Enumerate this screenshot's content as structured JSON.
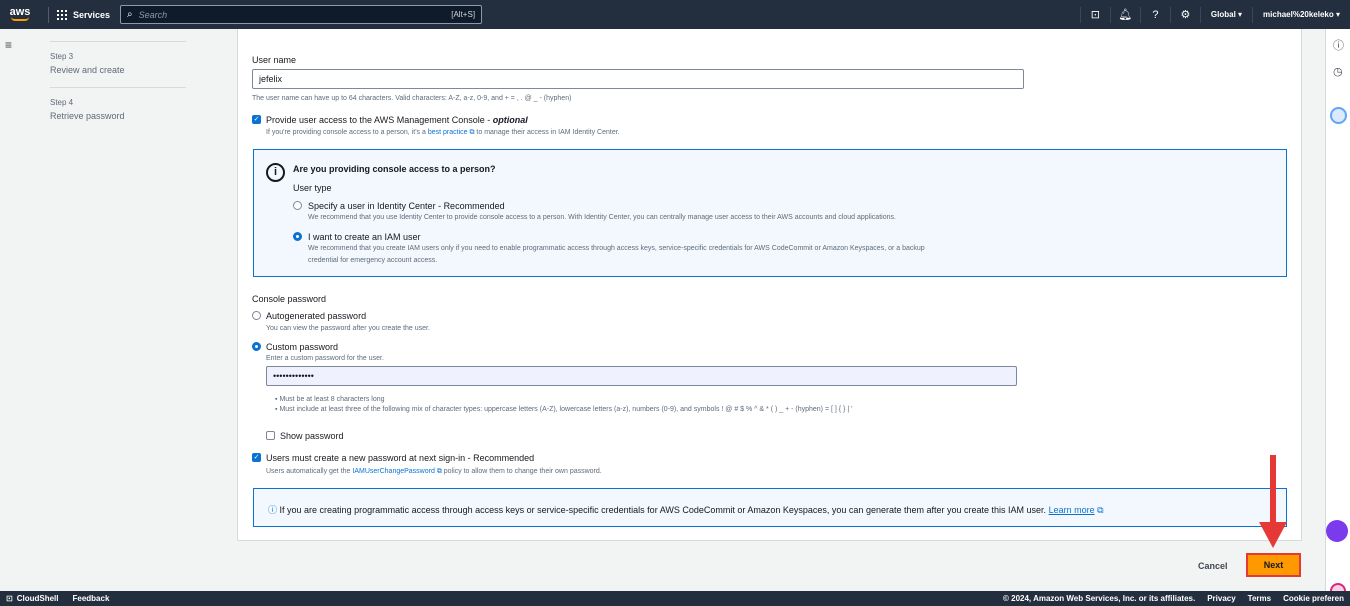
{
  "topnav": {
    "logo": "aws",
    "services": "Services",
    "search_placeholder": "Search",
    "search_shortcut": "[Alt+S]",
    "region": "Global ▾",
    "account": "michael%20keleko ▾"
  },
  "steps": [
    {
      "num": "Step 3",
      "name": "Review and create"
    },
    {
      "num": "Step 4",
      "name": "Retrieve password"
    }
  ],
  "form": {
    "username_label": "User name",
    "username_value": "jefelix",
    "username_hint": "The user name can have up to 64 characters. Valid characters: A-Z, a-z, 0-9, and + = , . @ _ - (hyphen)",
    "console_access_label": "Provide user access to the AWS Management Console - ",
    "console_access_optional": "optional",
    "console_access_hint_pre": "If you're providing console access to a person, it's a ",
    "console_access_hint_link": "best practice",
    "console_access_hint_post": " to manage their access in IAM Identity Center.",
    "info_title": "Are you providing console access to a person?",
    "user_type_label": "User type",
    "opt_identity_center": "Specify a user in Identity Center - Recommended",
    "opt_identity_center_desc": "We recommend that you use Identity Center to provide console access to a person. With Identity Center, you can centrally manage user access to their AWS accounts and cloud applications.",
    "opt_iam_user": "I want to create an IAM user",
    "opt_iam_user_desc1": "We recommend that you create IAM users only if you need to enable programmatic access through access keys, service-specific credentials for AWS CodeCommit or Amazon Keyspaces, or a backup",
    "opt_iam_user_desc2": "credential for emergency account access.",
    "console_password_label": "Console password",
    "opt_autogen": "Autogenerated password",
    "opt_autogen_desc": "You can view the password after you create the user.",
    "opt_custom": "Custom password",
    "opt_custom_desc": "Enter a custom password for the user.",
    "password_value": "•••••••••••••",
    "rule1": "Must be at least 8 characters long",
    "rule2": "Must include at least three of the following mix of character types: uppercase letters (A-Z), lowercase letters (a-z), numbers (0-9), and symbols ! @ # $ % ^ & * ( ) _ + - (hyphen) = [ ] { } | '",
    "show_password": "Show password",
    "reset_label": "Users must create a new password at next sign-in - Recommended",
    "reset_hint_pre": "Users automatically get the ",
    "reset_hint_link": "IAMUserChangePassword",
    "reset_hint_post": " policy to allow them to change their own password.",
    "programmatic_info": "If you are creating programmatic access through access keys or service-specific credentials for AWS CodeCommit or Amazon Keyspaces, you can generate them after you create this IAM user.",
    "learn_more": "Learn more"
  },
  "actions": {
    "cancel": "Cancel",
    "next": "Next"
  },
  "footer": {
    "cloudshell": "CloudShell",
    "feedback": "Feedback",
    "copyright": "© 2024, Amazon Web Services, Inc. or its affiliates.",
    "privacy": "Privacy",
    "terms": "Terms",
    "cookie": "Cookie preferen"
  },
  "colors": {
    "nav_bg": "#232f3e",
    "accent": "#0972d3",
    "primary_button": "#ff9900",
    "highlight": "#e53935"
  }
}
